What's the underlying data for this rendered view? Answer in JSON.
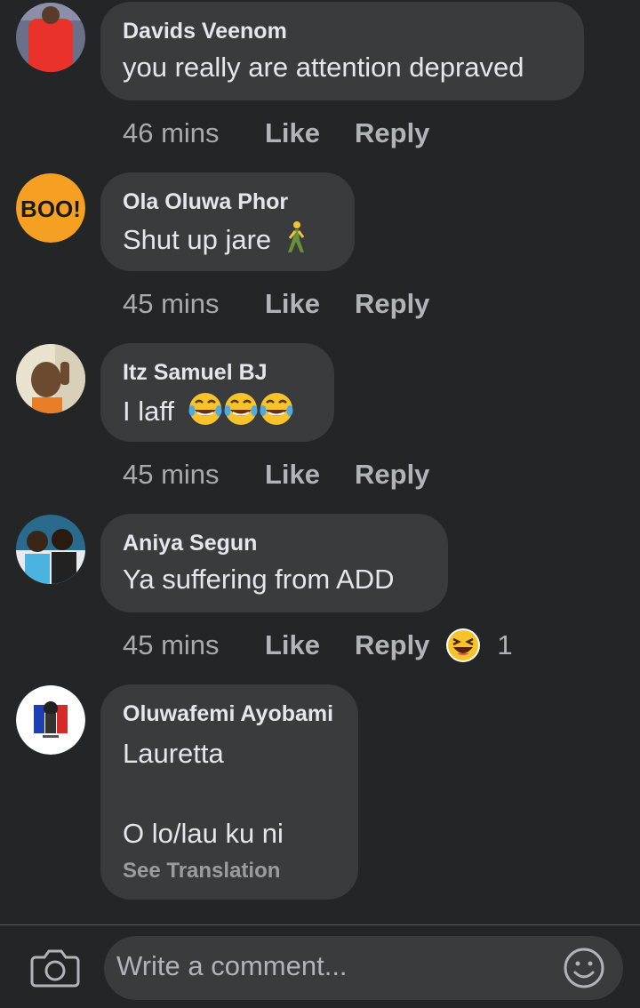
{
  "comments": [
    {
      "author": "Davids Veenom",
      "text": "you really are attention depraved",
      "time": "46 mins",
      "like": "Like",
      "reply": "Reply"
    },
    {
      "author": "Ola Oluwa Phor",
      "text": "Shut up jare",
      "emoji": "person-walking-emoji",
      "time": "45 mins",
      "like": "Like",
      "reply": "Reply"
    },
    {
      "author": "Itz Samuel BJ",
      "text": "I laff",
      "emoji": "tears-of-joy-emoji x3",
      "time": "45 mins",
      "like": "Like",
      "reply": "Reply"
    },
    {
      "author": "Aniya Segun",
      "text": "Ya suffering from ADD",
      "time": "45 mins",
      "like": "Like",
      "reply": "Reply",
      "reaction_icon": "laughing-reaction-icon",
      "reaction_count": "1"
    },
    {
      "author": "Oluwafemi Ayobami",
      "text_line1": "Lauretta",
      "text_line2": "O lo/lau ku ni",
      "see_translation": "See Translation"
    }
  ],
  "composer": {
    "placeholder": "Write a comment...",
    "camera_icon": "camera-icon",
    "emoji_icon": "smiley-icon"
  },
  "colors": {
    "background": "#242526",
    "bubble": "#3a3b3c",
    "text": "#e4e6eb",
    "meta": "#b0b3b8"
  }
}
